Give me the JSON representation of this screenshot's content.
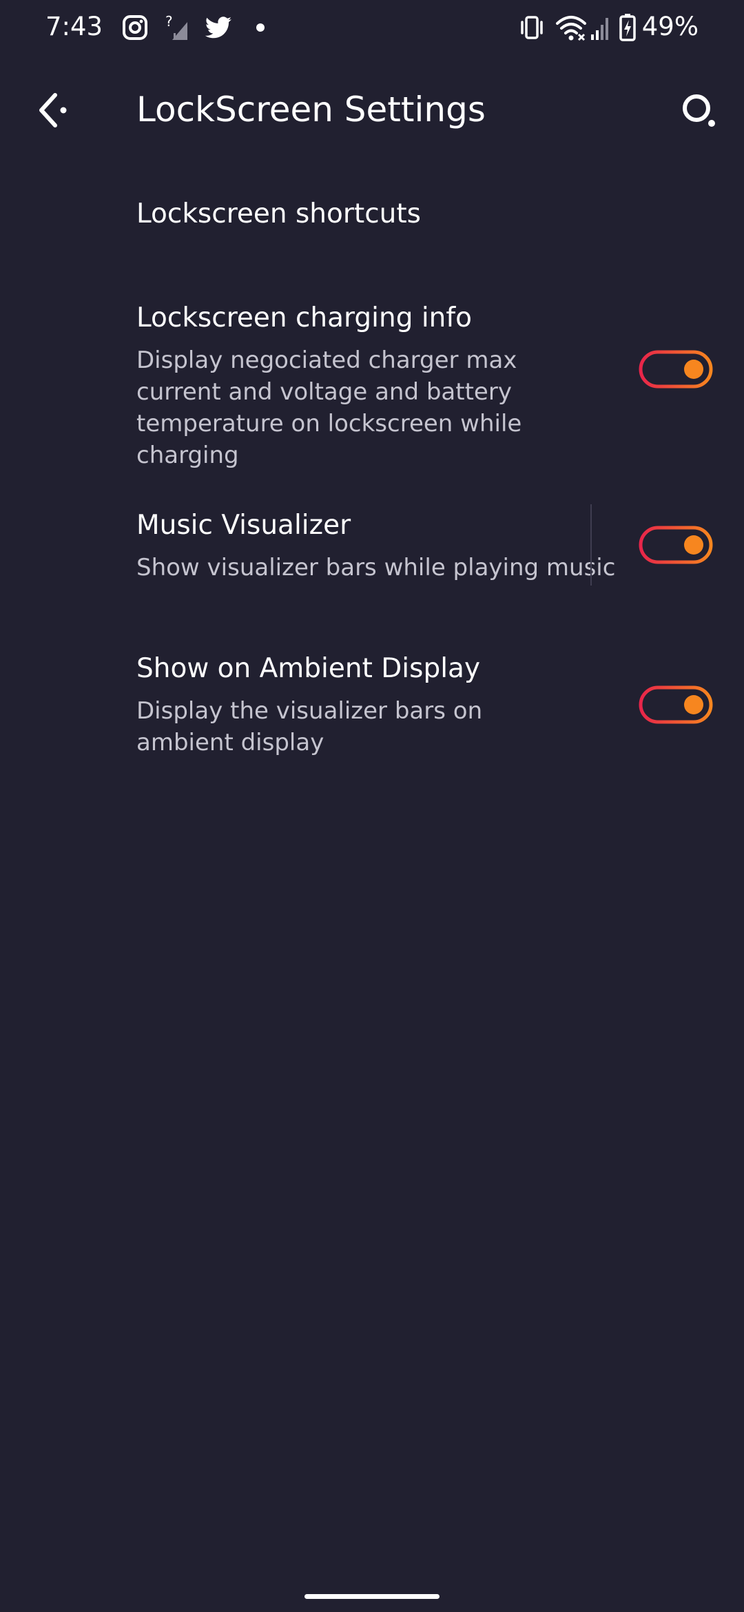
{
  "status_bar": {
    "time": "7:43",
    "battery_percent": "49%",
    "icons": [
      "instagram-icon",
      "signal-unknown-icon",
      "twitter-icon",
      "notification-dot-icon",
      "vibrate-icon",
      "wifi-icon",
      "cell-signal-icon",
      "battery-charging-icon"
    ]
  },
  "app_bar": {
    "title": "LockScreen Settings",
    "back_icon": "back-arrow-icon",
    "search_icon": "search-icon"
  },
  "preferences": [
    {
      "title": "Lockscreen shortcuts",
      "summary": "",
      "has_toggle": false
    },
    {
      "title": "Lockscreen charging info",
      "summary": "Display negociated charger max current and voltage and battery temperature on lockscreen while charging",
      "has_toggle": true,
      "checked": true
    },
    {
      "title": "Music Visualizer",
      "summary": "Show visualizer bars while playing music",
      "has_toggle": true,
      "checked": true
    },
    {
      "title": "Show on Ambient Display",
      "summary": "Display the visualizer bars on ambient display",
      "has_toggle": true,
      "checked": true
    }
  ],
  "colors": {
    "background": "#212030",
    "toggle_gradient_start": "#e8254a",
    "toggle_gradient_end": "#f7861f",
    "thumb": "#f7861f",
    "summary_text": "#c5c4cf"
  }
}
